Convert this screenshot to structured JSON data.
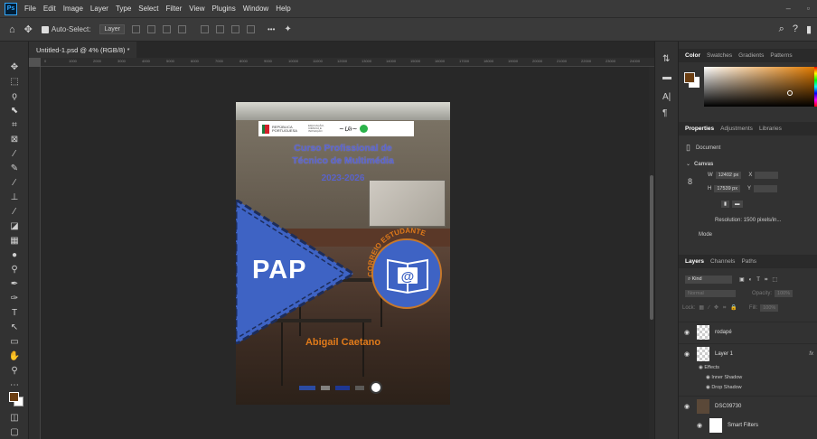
{
  "app": {
    "logo_text": "Ps"
  },
  "menu": [
    "File",
    "Edit",
    "Image",
    "Layer",
    "Type",
    "Select",
    "Filter",
    "View",
    "Plugins",
    "Window",
    "Help"
  ],
  "options_bar": {
    "auto_select_label": "Auto-Select:",
    "auto_select_value": "Layer"
  },
  "document_tab": {
    "title": "Untitled-1.psd @ 4% (RGB/8) *"
  },
  "ruler_ticks": [
    "0",
    "1000",
    "2000",
    "3000",
    "4000",
    "5000",
    "6000",
    "7000",
    "8000",
    "9000",
    "10000",
    "11000",
    "12000",
    "13000",
    "14000",
    "15000",
    "16000",
    "17000",
    "18000",
    "19000",
    "20000",
    "21000",
    "22000",
    "23000",
    "24000"
  ],
  "artwork": {
    "logo_text_1": "REPÚBLICA PORTUGUESA",
    "logo_text_2": "EDUCAÇÃO, CIÊNCIA E INOVAÇÃO",
    "title_line_1": "Curso Profissional de",
    "title_line_2": "Técnico de Multimédia",
    "year": "2023-2026",
    "pap": "PAP",
    "arc_text": "CORREIO ESTUDANTE",
    "at_symbol": "@",
    "author": "Abigail Caetano"
  },
  "panels": {
    "color_tabs": [
      "Color",
      "Swatches",
      "Gradients",
      "Patterns"
    ],
    "properties_tabs": [
      "Properties",
      "Adjustments",
      "Libraries"
    ],
    "document_label": "Document",
    "canvas_label": "Canvas",
    "width_label": "W",
    "width_value": "12402 px",
    "height_label": "H",
    "height_value": "17539 px",
    "x_label": "X",
    "y_label": "Y",
    "resolution": "Resolution: 1500 pixels/in...",
    "mode_label": "Mode",
    "layers_tabs": [
      "Layers",
      "Channels",
      "Paths"
    ],
    "kind_label": "Kind",
    "blend_mode": "Normal",
    "opacity_label": "Opacity:",
    "opacity_value": "100%",
    "lock_label": "Lock:",
    "fill_label": "Fill:",
    "fill_value": "100%",
    "layers": [
      {
        "name": "rodapé"
      },
      {
        "name": "Layer 1",
        "fx": "fx"
      },
      {
        "name": "DSC09730"
      }
    ],
    "effects_label": "Effects",
    "effect_1": "Inner Shadow",
    "effect_2": "Drop Shadow",
    "smart_filters": "Smart Filters"
  },
  "colors": {
    "foreground": "#6b3e12",
    "background": "#ffffff",
    "title_blue": "#5a63c8",
    "accent_orange": "#e07a1a",
    "shape_blue": "#3e63c4"
  }
}
